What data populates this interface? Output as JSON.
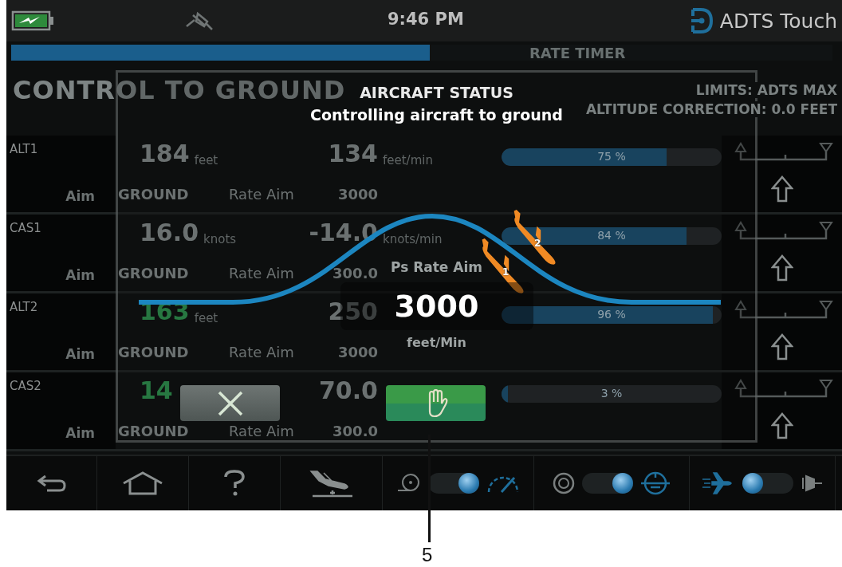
{
  "status_bar": {
    "time": "9:46 PM",
    "brand": "ADTS Touch"
  },
  "rate_timer": {
    "label": "RATE TIMER",
    "level": 0.51
  },
  "title": "CONTROL TO GROUND",
  "limits": "LIMITS: ADTS MAX",
  "altitude_correction": "ALTITUDE CORRECTION: 0.0 FEET",
  "channels": [
    {
      "name": "ALT1",
      "value": "184",
      "unit": "feet",
      "in_control": false,
      "aim_label": "Aim",
      "aim": "GROUND",
      "rate": "134",
      "rate_unit": "feet/min",
      "rate_aim_label": "Rate Aim",
      "rate_aim": "3000",
      "percent": "75 %",
      "level": 0.75
    },
    {
      "name": "CAS1",
      "value": "16.0",
      "unit": "knots",
      "in_control": false,
      "aim_label": "Aim",
      "aim": "GROUND",
      "rate": "-14.0",
      "rate_unit": "knots/min",
      "rate_aim_label": "Rate Aim",
      "rate_aim": "300.0",
      "percent": "84 %",
      "level": 0.84
    },
    {
      "name": "ALT2",
      "value": "163",
      "unit": "feet",
      "in_control": true,
      "aim_label": "Aim",
      "aim": "GROUND",
      "rate": "250",
      "rate_aim_label": "Rate Aim",
      "rate_aim": "3000",
      "percent": "96 %",
      "level": 0.96
    },
    {
      "name": "CAS2",
      "value": "14",
      "in_control": true,
      "aim_label": "Aim",
      "aim": "GROUND",
      "rate": "70.0",
      "rate_aim_label": "Rate Aim",
      "rate_aim": "300.0",
      "percent": "3 %",
      "level": 0.03
    }
  ],
  "dialog": {
    "title": "AIRCRAFT STATUS",
    "message": "Controlling aircraft to ground",
    "aim_label": "Ps Rate Aim",
    "aim_value": "3000",
    "aim_unit": "feet/Min",
    "aircraft": [
      {
        "number": "1"
      },
      {
        "number": "2"
      }
    ],
    "buttons": [
      {
        "kind": "cancel"
      },
      {
        "kind": "hold"
      }
    ]
  },
  "nav": [
    {
      "kind": "back"
    },
    {
      "kind": "home"
    },
    {
      "kind": "help"
    },
    {
      "kind": "landing"
    }
  ],
  "toggles": [
    {
      "on": true
    },
    {
      "on": true
    },
    {
      "on": false
    }
  ],
  "callout": "5"
}
